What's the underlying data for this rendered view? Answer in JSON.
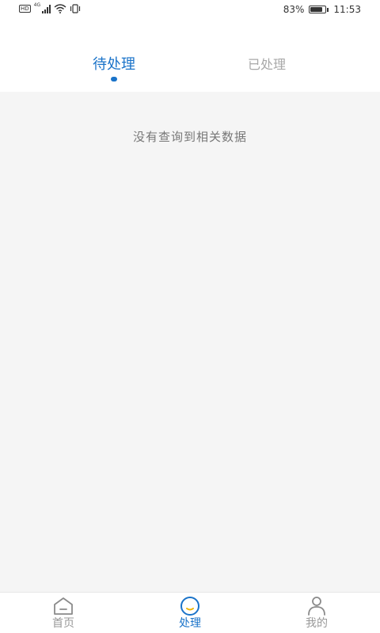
{
  "status_bar": {
    "hd": "HD",
    "network": "4G",
    "battery_percent": "83%",
    "battery_level": 0.83,
    "time": "11:53"
  },
  "tabs": {
    "pending_label": "待处理",
    "done_label": "已处理"
  },
  "content": {
    "empty_message": "没有查询到相关数据"
  },
  "bottom_nav": {
    "items": [
      {
        "label": "首页",
        "icon": "home-icon"
      },
      {
        "label": "处理",
        "icon": "process-icon"
      },
      {
        "label": "我的",
        "icon": "person-icon"
      }
    ],
    "active_index": 1
  },
  "colors": {
    "accent": "#1a73c9",
    "inactive": "#999999",
    "background": "#f5f5f5"
  }
}
